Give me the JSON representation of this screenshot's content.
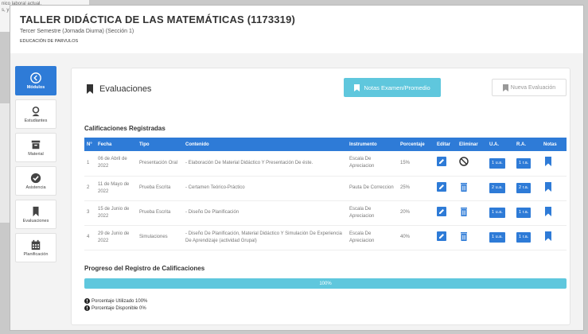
{
  "background_doc": {
    "line1": "nico laboral actual.",
    "line2": "s, y"
  },
  "header": {
    "course_title": "TALLER DIDÁCTICA DE LAS MATEMÁTICAS (1173319)",
    "subtitle": "Tercer Semestre (Jornada Diurna) (Sección 1)",
    "career": "EDUCACIÓN DE PARVULOS"
  },
  "sidebar": {
    "items": [
      {
        "label": "Módulos",
        "icon": "arrow-left-circle-icon",
        "active": true
      },
      {
        "label": "Estudiantes",
        "icon": "user-icon"
      },
      {
        "label": "Material",
        "icon": "archive-box-icon"
      },
      {
        "label": "Asistencia",
        "icon": "check-circle-icon"
      },
      {
        "label": "Evaluaciones",
        "icon": "bookmark-icon"
      },
      {
        "label": "Planificación",
        "icon": "calendar-icon"
      }
    ]
  },
  "panel": {
    "title": "Evaluaciones",
    "notas_button": "Notas Examen/Promedio",
    "nueva_button": "Nueva Evaluación",
    "section_title": "Calificaciones Registradas"
  },
  "table": {
    "headers": [
      "N°",
      "Fecha",
      "Tipo",
      "Contenido",
      "Instrumento",
      "Porcentaje",
      "Editar",
      "Eliminar",
      "U.A.",
      "R.A.",
      "Notas"
    ],
    "rows": [
      {
        "n": "1",
        "fecha": "06 de Abril de 2022",
        "tipo": "Presentación Oral",
        "contenido": "- Elaboración De Material Didáctico Y Presentación De éste.",
        "instrumento": "Escala De Apreciacion",
        "porcentaje": "15%",
        "delete_icon": "ban-icon",
        "ua": "1 u.a.",
        "ra": "1 r.a."
      },
      {
        "n": "2",
        "fecha": "11 de Mayo de 2022",
        "tipo": "Prueba Escrita",
        "contenido": "- Certamen Teórico-Práctico",
        "instrumento": "Pauta De Correccion",
        "porcentaje": "25%",
        "delete_icon": "trash-icon",
        "ua": "2 u.a.",
        "ra": "2 r.a."
      },
      {
        "n": "3",
        "fecha": "15 de Junio de 2022",
        "tipo": "Prueba Escrita",
        "contenido": "- Diseño De Planificación",
        "instrumento": "Escala De Apreciacion",
        "porcentaje": "20%",
        "delete_icon": "trash-icon",
        "ua": "1 u.a.",
        "ra": "1 r.a."
      },
      {
        "n": "4",
        "fecha": "29 de Junio de 2022",
        "tipo": "Simulaciones",
        "contenido": "- Diseño De Planificación, Material Didáctico Y Simulación De Experiencia De Aprendizaje (actividad Grupal)",
        "instrumento": "Escala De Apreciacion",
        "porcentaje": "40%",
        "delete_icon": "trash-icon",
        "ua": "1 u.a.",
        "ra": "1 r.a."
      }
    ]
  },
  "progress": {
    "title": "Progreso del Registro de Calificaciones",
    "label": "100%",
    "value": 100,
    "used": "Porcentaje Utilizado 100%",
    "available": "Porcentaje Disponible 0%"
  },
  "colors": {
    "primary": "#2e7bd7",
    "accent": "#5fc7dd"
  }
}
